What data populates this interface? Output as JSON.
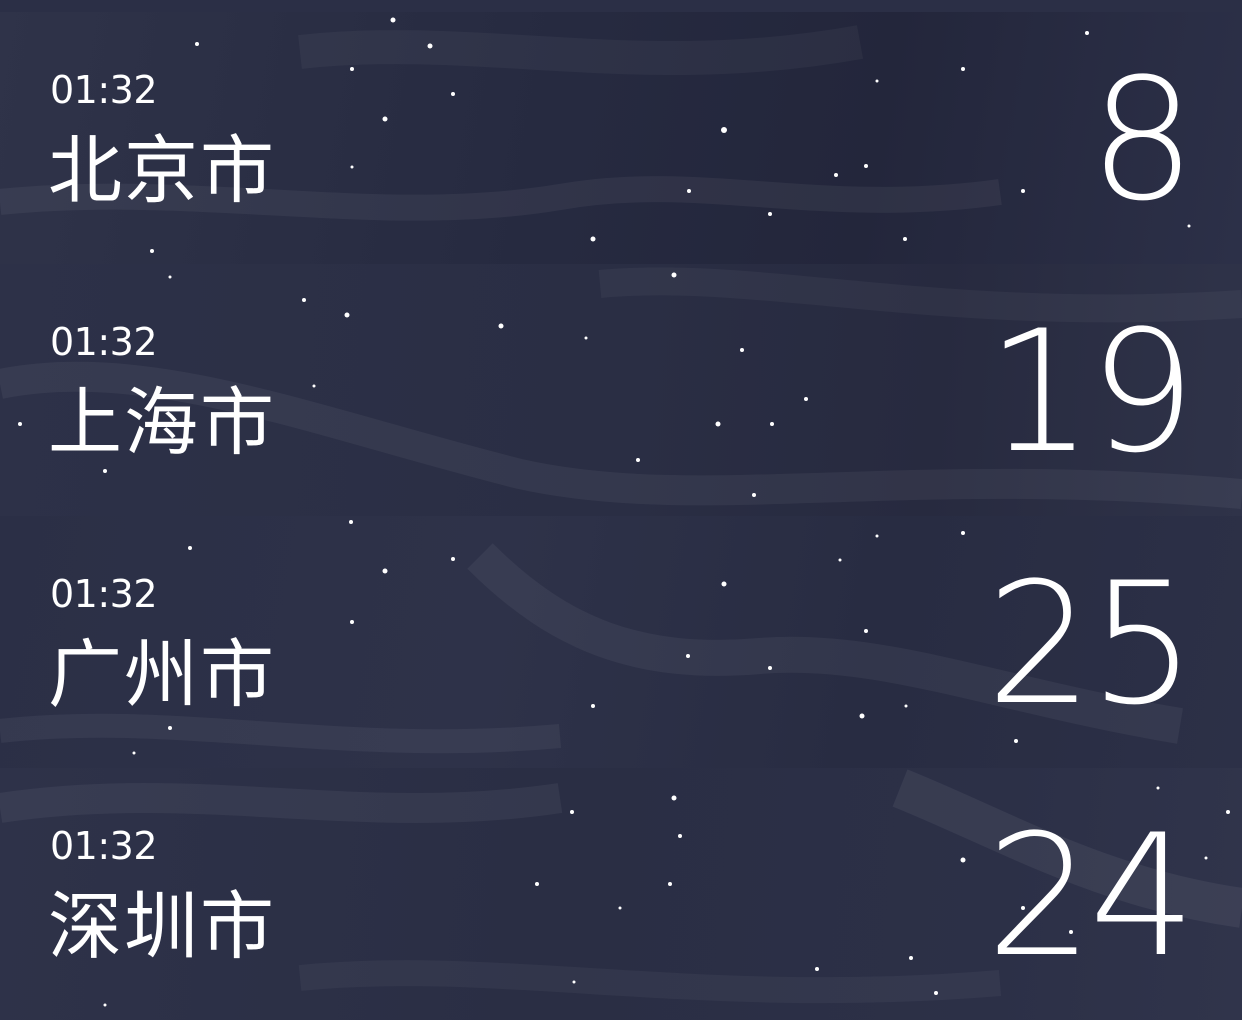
{
  "cities": [
    {
      "time": "01:32",
      "name": "北京市",
      "temperature": "8"
    },
    {
      "time": "01:32",
      "name": "上海市",
      "temperature": "19"
    },
    {
      "time": "01:32",
      "name": "广州市",
      "temperature": "25"
    },
    {
      "time": "01:32",
      "name": "深圳市",
      "temperature": "24"
    }
  ],
  "colors": {
    "background": "#2a2e45",
    "text": "#ffffff",
    "star": "#ffffff"
  }
}
